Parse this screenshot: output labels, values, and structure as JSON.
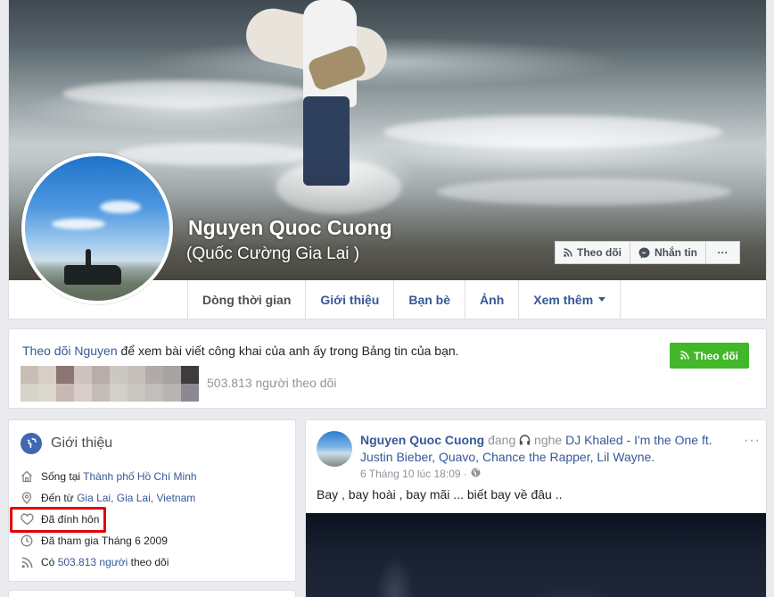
{
  "profile": {
    "name": "Nguyen Quoc Cuong",
    "alternate_name": "(Quốc Cường Gia Lai )"
  },
  "cover_actions": {
    "follow": "Theo dõi",
    "message": "Nhắn tin",
    "more": "···"
  },
  "tabs": [
    {
      "label": "Dòng thời gian",
      "active": true
    },
    {
      "label": "Giới thiệu"
    },
    {
      "label": "Bạn bè"
    },
    {
      "label": "Ảnh"
    },
    {
      "label": "Xem thêm"
    }
  ],
  "follow_card": {
    "text_link": "Theo dõi Nguyen",
    "text_rest": " để xem bài viết công khai của anh ấy trong Bảng tin của bạn.",
    "button": "Theo dõi",
    "follower_count": "503.813 người theo dõi",
    "mosaic_colors": [
      "#c8bfb4",
      "#d7cfc6",
      "#8c7674",
      "#cfc2c1",
      "#b9aea7",
      "#cbc8c4",
      "#c4bfbb",
      "#b0abaa",
      "#a7a3a2",
      "#3e3a3e",
      "#d6d4c9",
      "#dcd8cf",
      "#c8b8b4",
      "#d8cdca",
      "#c3bdb6",
      "#d2d0cb",
      "#cac6c2",
      "#c2bebc",
      "#b8b4b4",
      "#8c8890"
    ]
  },
  "intro": {
    "title": "Giới thiệu",
    "lives_prefix": "Sống tại ",
    "lives_city": "Thành phố Hồ Chí Minh",
    "from_prefix": "Đến từ ",
    "from_place": "Gia Lai, Gia Lai, Vietnam",
    "relationship": "Đã đính hôn",
    "joined": "Đã tham gia Tháng 6 2009",
    "followers_prefix": "Có ",
    "followers_link": "503.813 người",
    "followers_suffix": " theo dõi"
  },
  "post": {
    "author": "Nguyen Quoc Cuong",
    "activity_verb": " đang ",
    "activity": " nghe ",
    "song": "DJ Khaled - I'm the One ft. Justin Bieber, Quavo, Chance the Rapper, Lil Wayne",
    "song_end": ".",
    "timestamp": "6 Tháng 10 lúc 18:09 ·",
    "more": "···",
    "text": "Bay , bay hoài , bay mãi ... biết bay về đâu .."
  },
  "colors": {
    "link": "#365899",
    "green_button": "#42b72a",
    "highlight_box": "#e50000"
  }
}
